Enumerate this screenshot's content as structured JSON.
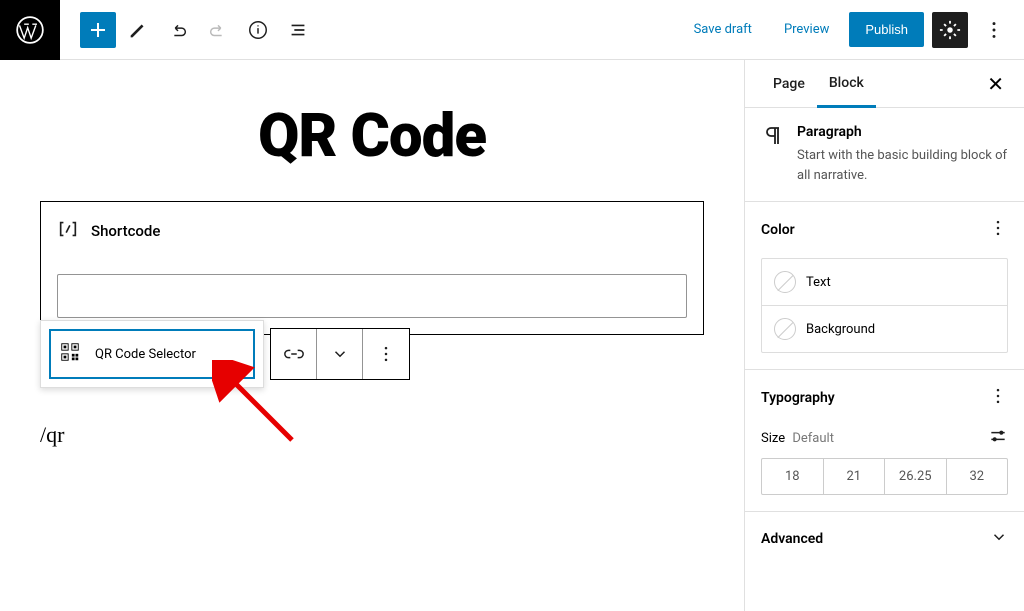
{
  "toolbar": {
    "save_draft": "Save draft",
    "preview": "Preview",
    "publish": "Publish"
  },
  "editor": {
    "title": "QR Code",
    "shortcode_label": "Shortcode",
    "suggestion": "QR Code Selector",
    "slash_text": "/qr"
  },
  "sidebar": {
    "tabs": {
      "page": "Page",
      "block": "Block"
    },
    "block_info": {
      "name": "Paragraph",
      "desc": "Start with the basic building block of all narrative."
    },
    "color": {
      "title": "Color",
      "text": "Text",
      "background": "Background"
    },
    "typography": {
      "title": "Typography",
      "size_label": "Size",
      "size_default": "Default",
      "presets": [
        "18",
        "21",
        "26.25",
        "32"
      ]
    },
    "advanced": "Advanced"
  }
}
